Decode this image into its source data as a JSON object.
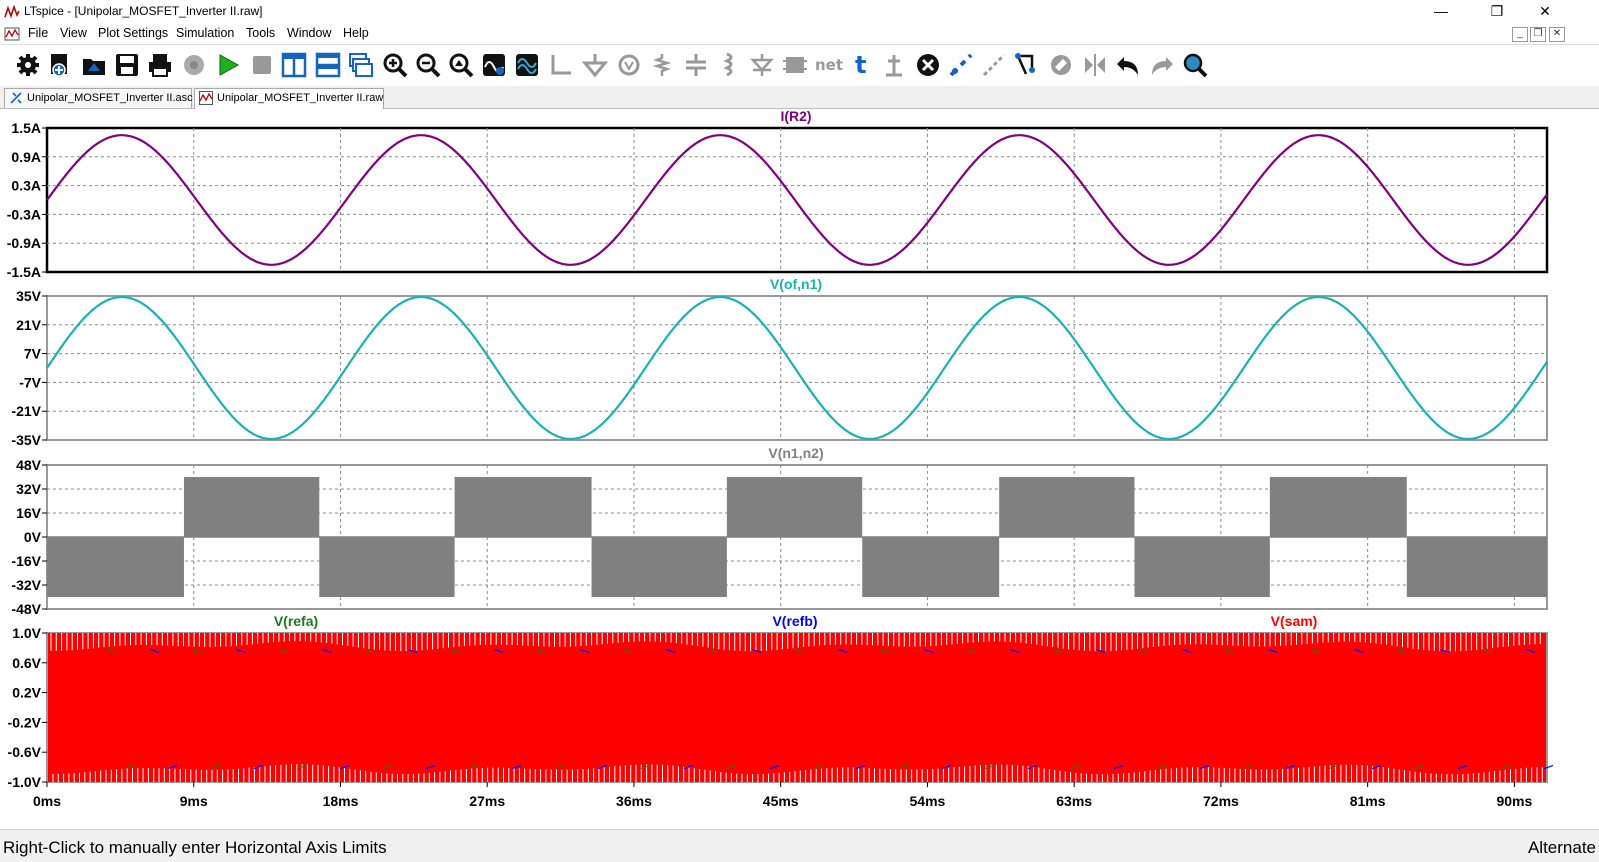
{
  "window": {
    "title": "LTspice - [Unipolar_MOSFET_Inverter II.raw]",
    "minimize": "—",
    "restore": "❐",
    "close": "✕"
  },
  "menu": {
    "items": [
      "File",
      "View",
      "Plot Settings",
      "Simulation",
      "Tools",
      "Window",
      "Help"
    ],
    "mdi_minimize": "_",
    "mdi_restore": "❐",
    "mdi_close": "✕"
  },
  "toolbar": {
    "icons": [
      "gear-icon",
      "new-schematic-icon",
      "open-icon",
      "save-icon",
      "print-icon",
      "cog-disabled-icon",
      "run-icon",
      "halt-icon",
      "tile-vertical-icon",
      "tile-horizontal-icon",
      "cascade-icon",
      "zoom-in-icon",
      "zoom-out-icon",
      "zoom-fit-icon",
      "autorange-icon",
      "cursor-icon",
      "wire-icon",
      "ground-icon",
      "bubble-icon",
      "resistor-icon",
      "capacitor-icon",
      "inductor-icon",
      "diode-icon",
      "component-icon",
      "net-label-icon",
      "text-icon",
      "spice-directive-icon",
      "delete-icon",
      "duplicate-icon",
      "move-icon",
      "drag-icon",
      "rotate-icon",
      "mirror-icon",
      "undo-icon",
      "redo-icon",
      "find-icon"
    ]
  },
  "tabs": [
    {
      "label": "Unipolar_MOSFET_Inverter II.asc",
      "icon": "schematic-icon",
      "active": false
    },
    {
      "label": "Unipolar_MOSFET_Inverter II.raw",
      "icon": "waveform-icon",
      "active": true
    }
  ],
  "status": {
    "left": "Right-Click to manually enter Horizontal Axis Limits",
    "right": "Alternate"
  },
  "colors": {
    "i_r2": "#800080",
    "v_of_n1": "#19b2b2",
    "v_n1_n2": "#808080",
    "v_refa": "#1c7a1c",
    "v_refb": "#0000ff",
    "v_sam": "#ff0000",
    "grid": "#8c8c8c"
  },
  "chart_data": [
    {
      "type": "line",
      "title": "I(R2)",
      "series": [
        {
          "name": "I(R2)",
          "amplitude": 1.35,
          "frequency_hz": 54.5,
          "phase_deg": 0
        }
      ],
      "xlim": [
        0,
        92
      ],
      "ylim": [
        -1.5,
        1.5
      ],
      "yticks": [
        "1.5A",
        "0.9A",
        "0.3A",
        "-0.3A",
        "-0.9A",
        "-1.5A"
      ],
      "selected": true
    },
    {
      "type": "line",
      "title": "V(of,n1)",
      "series": [
        {
          "name": "V(of,n1)",
          "amplitude": 34.5,
          "frequency_hz": 54.5,
          "phase_deg": 0
        }
      ],
      "xlim": [
        0,
        92
      ],
      "ylim": [
        -35,
        35
      ],
      "yticks": [
        "35V",
        "21V",
        "7V",
        "-7V",
        "-21V",
        "-35V"
      ]
    },
    {
      "type": "area",
      "title": "V(n1,n2)",
      "series": [
        {
          "name": "V(n1,n2)",
          "levels": [
            0,
            40
          ],
          "segments": [
            {
              "x": [
                0,
                8.4
              ],
              "range": [
                -40,
                0
              ]
            },
            {
              "x": [
                8.4,
                16.7
              ],
              "range": [
                0,
                40
              ]
            },
            {
              "x": [
                16.7,
                25.0
              ],
              "range": [
                -40,
                0
              ]
            },
            {
              "x": [
                25.0,
                33.4
              ],
              "range": [
                0,
                40
              ]
            },
            {
              "x": [
                33.4,
                41.7
              ],
              "range": [
                -40,
                0
              ]
            },
            {
              "x": [
                41.7,
                50.0
              ],
              "range": [
                0,
                40
              ]
            },
            {
              "x": [
                50.0,
                58.4
              ],
              "range": [
                -40,
                0
              ]
            },
            {
              "x": [
                58.4,
                66.7
              ],
              "range": [
                0,
                40
              ]
            },
            {
              "x": [
                66.7,
                75.0
              ],
              "range": [
                -40,
                0
              ]
            },
            {
              "x": [
                75.0,
                83.4
              ],
              "range": [
                0,
                40
              ]
            },
            {
              "x": [
                83.4,
                92.0
              ],
              "range": [
                -40,
                0
              ]
            }
          ]
        }
      ],
      "xlim": [
        0,
        92
      ],
      "ylim": [
        -48,
        48
      ],
      "yticks": [
        "48V",
        "32V",
        "16V",
        "0V",
        "-16V",
        "-32V",
        "-48V"
      ]
    },
    {
      "type": "area",
      "title": "",
      "series": [
        {
          "name": "V(refa)"
        },
        {
          "name": "V(refb)"
        },
        {
          "name": "V(sam)",
          "range": [
            -1.0,
            1.0
          ]
        }
      ],
      "xlim": [
        0,
        92
      ],
      "ylim": [
        -1.0,
        1.0
      ],
      "yticks": [
        "1.0V",
        "0.6V",
        "0.2V",
        "-0.2V",
        "-0.6V",
        "-1.0V"
      ]
    }
  ],
  "x_axis": {
    "ticks": [
      "0ms",
      "9ms",
      "18ms",
      "27ms",
      "36ms",
      "45ms",
      "54ms",
      "63ms",
      "72ms",
      "81ms",
      "90ms"
    ],
    "values": [
      0,
      9,
      18,
      27,
      36,
      45,
      54,
      63,
      72,
      81,
      90
    ]
  }
}
